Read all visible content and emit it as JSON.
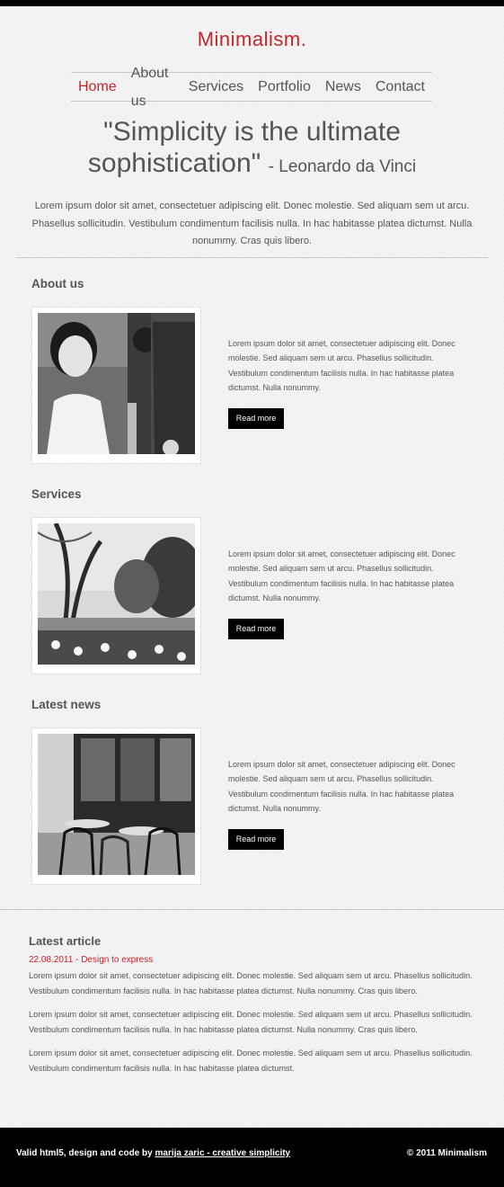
{
  "header": {
    "logo": "Minimalism.",
    "nav": [
      "Home",
      "About us",
      "Services",
      "Portfolio",
      "News",
      "Contact"
    ]
  },
  "hero": {
    "quote": "\"Simplicity is the ultimate sophistication\"",
    "author": "- Leonardo da Vinci",
    "intro": "Lorem ipsum dolor sit amet, consectetuer adipiscing elit. Donec molestie. Sed aliquam sem ut arcu. Phasellus sollicitudin. Vestibulum condimentum facilisis nulla. In hac habitasse platea dictumst. Nulla nonummy. Cras quis libero."
  },
  "sections": [
    {
      "title": "About us",
      "text": "Lorem ipsum dolor sit amet, consectetuer adipiscing elit. Donec molestie. Sed aliquam sem ut arcu. Phasellus sollicitudin. Vestibulum condimentum facilisis nulla. In hac habitasse platea dictumst. Nulla nonummy.",
      "button": "Read more"
    },
    {
      "title": "Services",
      "text": "Lorem ipsum dolor sit amet, consectetuer adipiscing elit. Donec molestie. Sed aliquam sem ut arcu. Phasellus sollicitudin. Vestibulum condimentum facilisis nulla. In hac habitasse platea dictumst. Nulla nonummy.",
      "button": "Read more"
    },
    {
      "title": "Latest news",
      "text": "Lorem ipsum dolor sit amet, consectetuer adipiscing elit. Donec molestie. Sed aliquam sem ut arcu. Phasellus sollicitudin. Vestibulum condimentum facilisis nulla. In hac habitasse platea dictumst. Nulla nonummy.",
      "button": "Read more"
    }
  ],
  "article": {
    "title": "Latest article",
    "date_line": "22.08.2011 - Design to express",
    "paragraphs": [
      "Lorem ipsum dolor sit amet, consectetuer adipiscing elit. Donec molestie. Sed aliquam sem ut arcu. Phasellus sollicitudin. Vestibulum condimentum facilisis nulla. In hac habitasse platea dictumst. Nulla nonummy. Cras quis libero.",
      "Lorem ipsum dolor sit amet, consectetuer adipiscing elit. Donec molestie. Sed aliquam sem ut arcu. Phasellus sollicitudin. Vestibulum condimentum facilisis nulla. In hac habitasse platea dictumst. Nulla nonummy. Cras quis libero.",
      "Lorem ipsum dolor sit amet, consectetuer adipiscing elit. Donec molestie. Sed aliquam sem ut arcu. Phasellus sollicitudin. Vestibulum condimentum facilisis nulla. In hac habitasse platea dictumst."
    ]
  },
  "footer": {
    "credit_prefix": "Valid html5, design and code by",
    "credit_link": "marija zaric - creative simplicity",
    "copyright": "© 2011 Minimalism"
  },
  "colors": {
    "accent": "#c0282d",
    "text": "#555555",
    "background": "#f3f3f3",
    "footer": "#000000"
  }
}
